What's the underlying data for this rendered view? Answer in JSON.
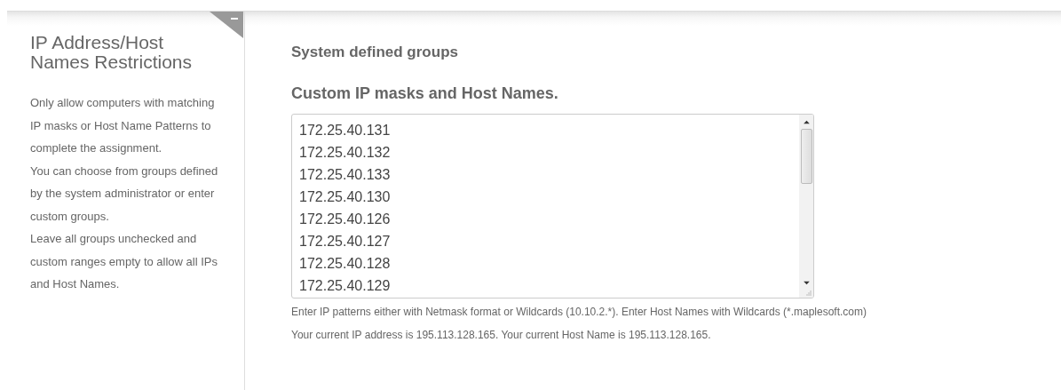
{
  "sidebar": {
    "title": "IP Address/Host Names Restrictions",
    "description": [
      "Only allow computers with matching IP masks or Host Name Patterns to complete the assignment.",
      "You can choose from groups defined by the system administrator or enter custom groups.",
      "Leave all groups unchecked and custom ranges empty to allow all IPs and Host Names."
    ]
  },
  "main": {
    "system_groups_heading": "System defined groups",
    "custom_heading": "Custom IP masks and Host Names.",
    "custom_entries": [
      "172.25.40.131",
      "172.25.40.132",
      "172.25.40.133",
      "172.25.40.130",
      "172.25.40.126",
      "172.25.40.127",
      "172.25.40.128",
      "172.25.40.129"
    ],
    "help_text": "Enter IP patterns either with Netmask format or Wildcards (10.10.2.*). Enter Host Names with Wildcards (*.maplesoft.com)",
    "current_info": "Your current IP address is 195.113.128.165. Your current Host Name is 195.113.128.165."
  }
}
